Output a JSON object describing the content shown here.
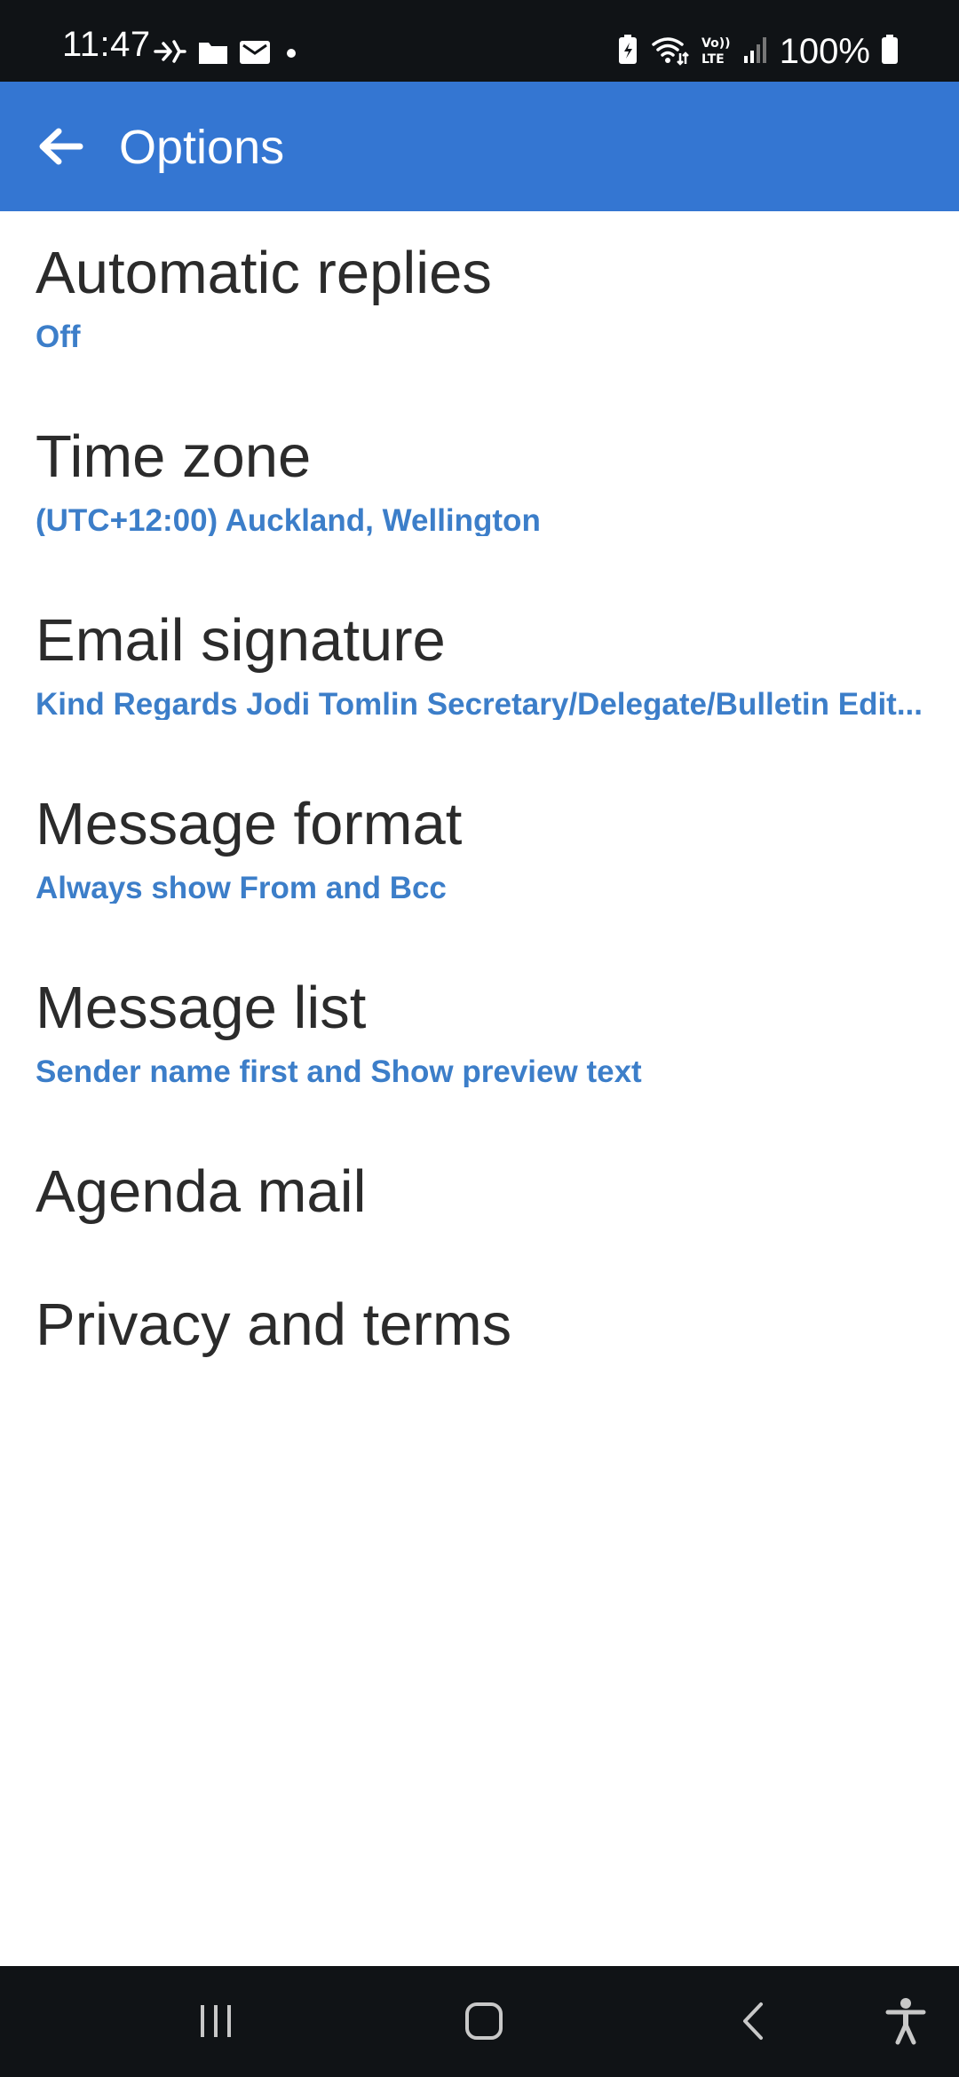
{
  "status_bar": {
    "time": "11:47",
    "battery": "100%",
    "left_icons": [
      "airplane-like-icon",
      "folder-icon",
      "mail-icon",
      "dot-icon"
    ],
    "right_icons": [
      "battery-saver-icon",
      "wifi-calling-icon",
      "volte-icon",
      "signal-icon",
      "battery-icon"
    ]
  },
  "app_bar": {
    "title": "Options",
    "back_icon": "arrow-left-icon",
    "color": "#3476d2"
  },
  "options": [
    {
      "title": "Automatic replies",
      "subtitle": "Off"
    },
    {
      "title": "Time zone",
      "subtitle": "(UTC+12:00) Auckland, Wellington"
    },
    {
      "title": "Email signature",
      "subtitle": "Kind Regards Jodi Tomlin Secretary/Delegate/Bulletin Edit..."
    },
    {
      "title": "Message format",
      "subtitle": "Always show From and Bcc"
    },
    {
      "title": "Message list",
      "subtitle": "Sender name first and Show preview text"
    },
    {
      "title": "Agenda mail"
    },
    {
      "title": "Privacy and terms"
    }
  ],
  "colors": {
    "accent": "#3476d2",
    "subtitle": "#3c7ec9",
    "title_text": "#2b2b2b",
    "system_bar": "#101316"
  },
  "nav_bar": {
    "icons": [
      "recent-apps-icon",
      "home-icon",
      "back-icon",
      "accessibility-icon"
    ]
  }
}
